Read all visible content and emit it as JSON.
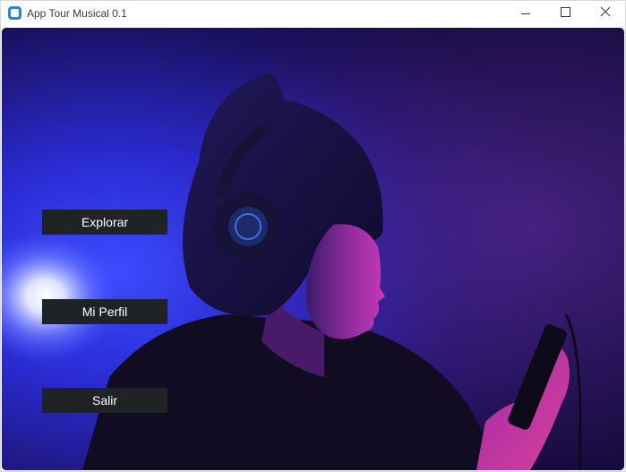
{
  "window": {
    "title": "App Tour Musical 0.1",
    "icon": "app-icon"
  },
  "controls": {
    "minimize_icon": "minimize-icon",
    "maximize_icon": "maximize-icon",
    "close_icon": "close-icon"
  },
  "background": {
    "image": "girl-with-headphones-photo",
    "colors": {
      "deep": "#150c45",
      "blue": "#2a3cff",
      "magenta": "#b82fc8",
      "glow": "#ffffff"
    }
  },
  "menu": {
    "explore_label": "Explorar",
    "profile_label": "Mi Perfil",
    "exit_label": "Salir",
    "button_color": "#1f2326"
  }
}
